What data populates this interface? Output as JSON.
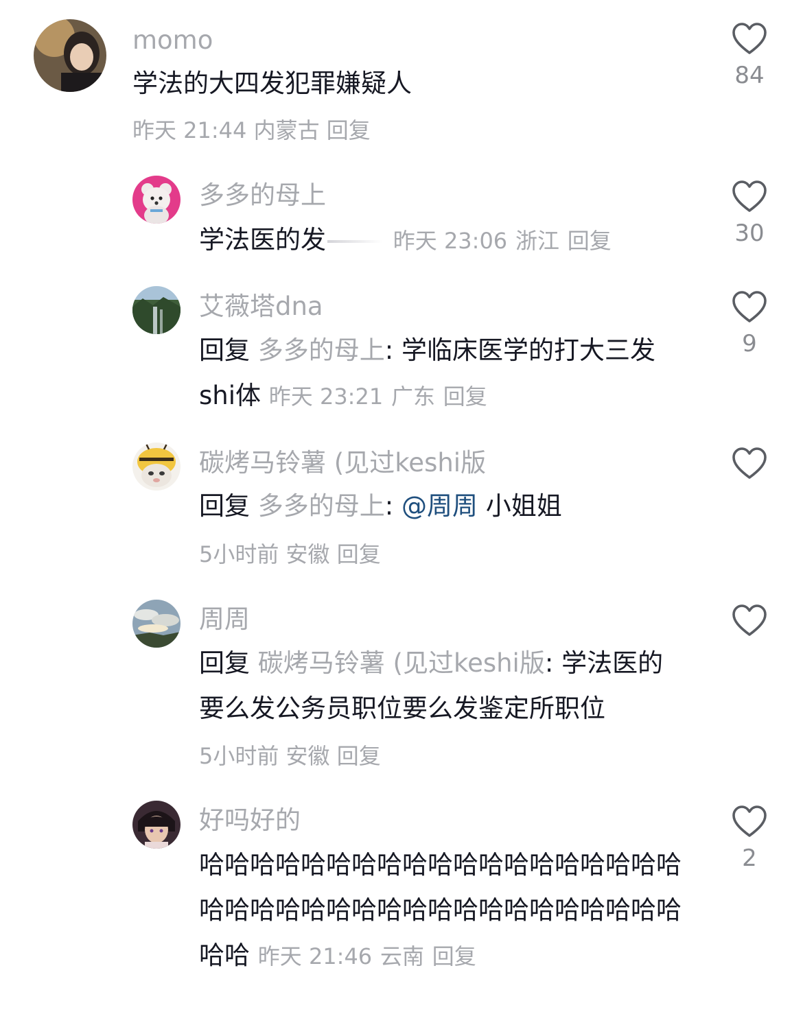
{
  "colors": {
    "muted": "#a6a8ad",
    "text": "#161823",
    "mention": "#1f4f7e",
    "heart_stroke": "#5a5d63"
  },
  "comments": [
    {
      "username": "momo",
      "text": "学法的大四发犯罪嫌疑人",
      "time": "昨天 21:44",
      "location": "内蒙古",
      "reply_label": "回复",
      "likes": "84",
      "avatar_icon": "user-avatar-photo-icon"
    },
    {
      "username": "多多的母上",
      "text": "学法医的发",
      "time": "昨天 23:06",
      "location": "浙江",
      "reply_label": "回复",
      "likes": "30",
      "avatar_icon": "poodle-avatar-icon"
    },
    {
      "username": "艾薇塔dna",
      "reply_word": "回复",
      "reply_to": "多多的母上",
      "text": ": 学临床医学的打大三发shi体",
      "time": "昨天 23:21",
      "location": "广东",
      "reply_label": "回复",
      "likes": "9",
      "avatar_icon": "landscape-avatar-icon"
    },
    {
      "username": "碳烤马铃薯 (见过keshi版",
      "reply_word": "回复",
      "reply_to": "多多的母上",
      "colon": ":",
      "mention": "@周周",
      "text": "小姐姐",
      "time": "5小时前",
      "location": "安徽",
      "reply_label": "回复",
      "likes": "",
      "avatar_icon": "cat-bee-avatar-icon"
    },
    {
      "username": "周周",
      "reply_word": "回复",
      "reply_to": "碳烤马铃薯 (见过keshi版",
      "text": ": 学法医的要么发公务员职位要么发鉴定所职位",
      "time": "5小时前",
      "location": "安徽",
      "reply_label": "回复",
      "likes": "",
      "avatar_icon": "sky-avatar-icon"
    },
    {
      "username": "好吗好的",
      "text": "哈哈哈哈哈哈哈哈哈哈哈哈哈哈哈哈哈哈哈哈哈哈哈哈哈哈哈哈哈哈哈哈哈哈哈哈哈哈哈哈",
      "time": "昨天 21:46",
      "location": "云南",
      "reply_label": "回复",
      "likes": "2",
      "avatar_icon": "anime-avatar-icon"
    }
  ]
}
